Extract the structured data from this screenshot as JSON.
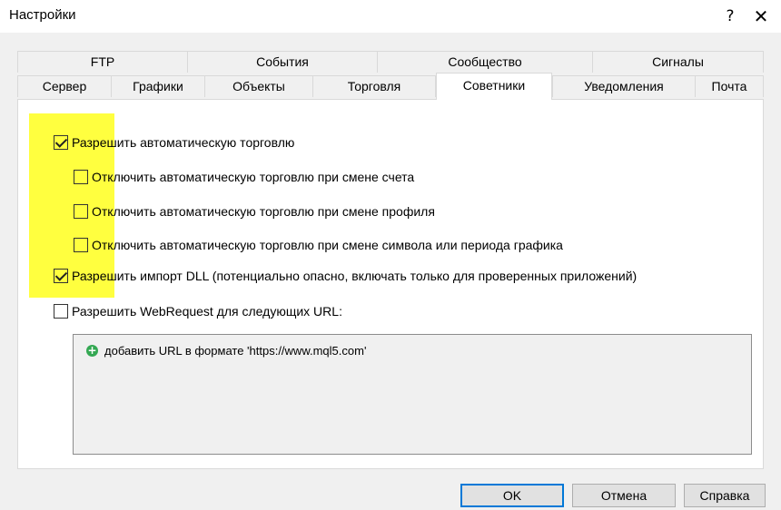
{
  "window": {
    "title": "Настройки",
    "help_label": "?",
    "close_label": "✕"
  },
  "tabs": {
    "row_top": [
      "FTP",
      "События",
      "Сообщество",
      "Сигналы"
    ],
    "row_bottom": [
      "Сервер",
      "Графики",
      "Объекты",
      "Торговля",
      "Советники",
      "Уведомления",
      "Почта"
    ],
    "active": "Советники"
  },
  "options": [
    {
      "label": "Разрешить автоматическую торговлю",
      "checked": true
    },
    {
      "label": "Отключить автоматическую торговлю при смене счета",
      "checked": false
    },
    {
      "label": "Отключить автоматическую торговлю при смене профиля",
      "checked": false
    },
    {
      "label": "Отключить автоматическую торговлю при смене символа или периода графика",
      "checked": false
    },
    {
      "label": "Разрешить импорт DLL (потенциально опасно, включать только для проверенных приложений)",
      "checked": true
    },
    {
      "label": "Разрешить WebRequest для следующих URL:",
      "checked": false
    }
  ],
  "url_list": {
    "add_label": "добавить URL в формате 'https://www.mql5.com'"
  },
  "buttons": {
    "ok": "OK",
    "cancel": "Отмена",
    "help": "Справка"
  },
  "colors": {
    "highlight": "#ffff35",
    "default_button_border": "#0078d7",
    "add_icon": "#34a853"
  }
}
